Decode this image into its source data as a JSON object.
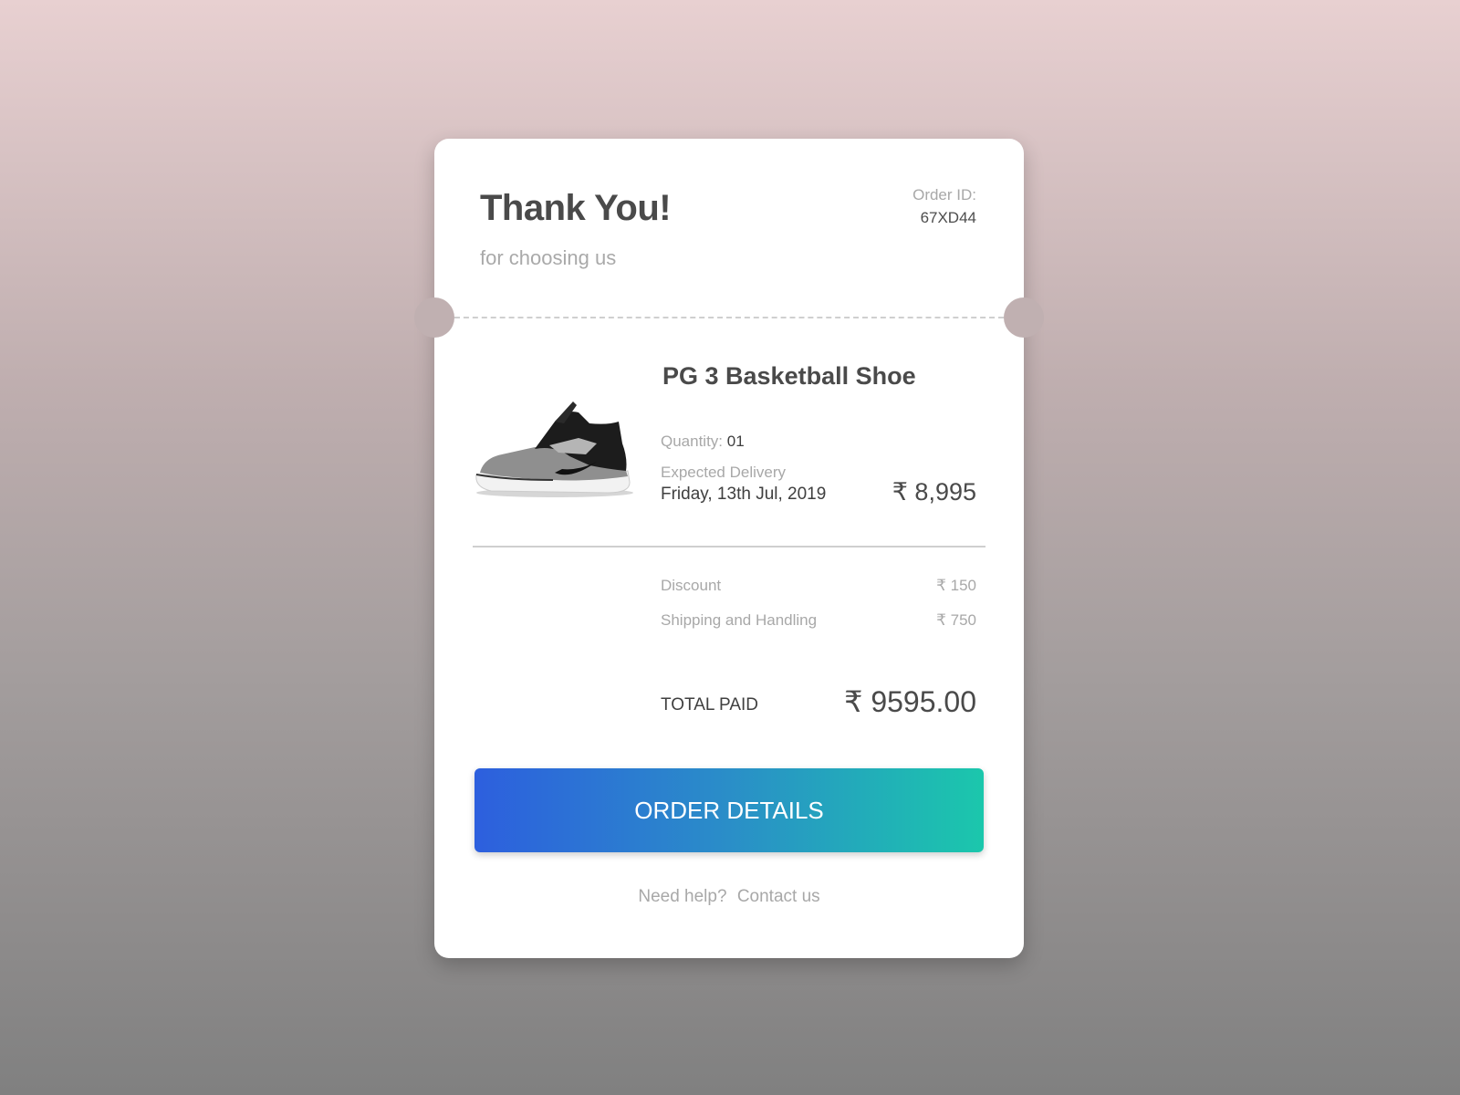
{
  "header": {
    "title": "Thank You!",
    "subtitle": "for choosing us",
    "order_id_label": "Order ID:",
    "order_id": "67XD44"
  },
  "product": {
    "image_icon": "basketball-shoe-image",
    "name": "PG 3 Basketball Shoe",
    "quantity_label": "Quantity:",
    "quantity": "01",
    "delivery_label": "Expected Delivery",
    "delivery_date": "Friday, 13th Jul, 2019",
    "price": "₹ 8,995"
  },
  "charges": {
    "discount_label": "Discount",
    "discount_value": "₹ 150",
    "shipping_label": "Shipping and Handling",
    "shipping_value": "₹ 750"
  },
  "total": {
    "label": "TOTAL PAID",
    "value": "₹ 9595.00"
  },
  "actions": {
    "order_details_label": "ORDER DETAILS",
    "help_label": "Need help?",
    "contact_label": "Contact us"
  },
  "colors": {
    "button_gradient_start": "#2d5fde",
    "button_gradient_end": "#1bc7ac",
    "text_primary": "#4a4a4a",
    "text_muted": "#a8a8a8"
  }
}
